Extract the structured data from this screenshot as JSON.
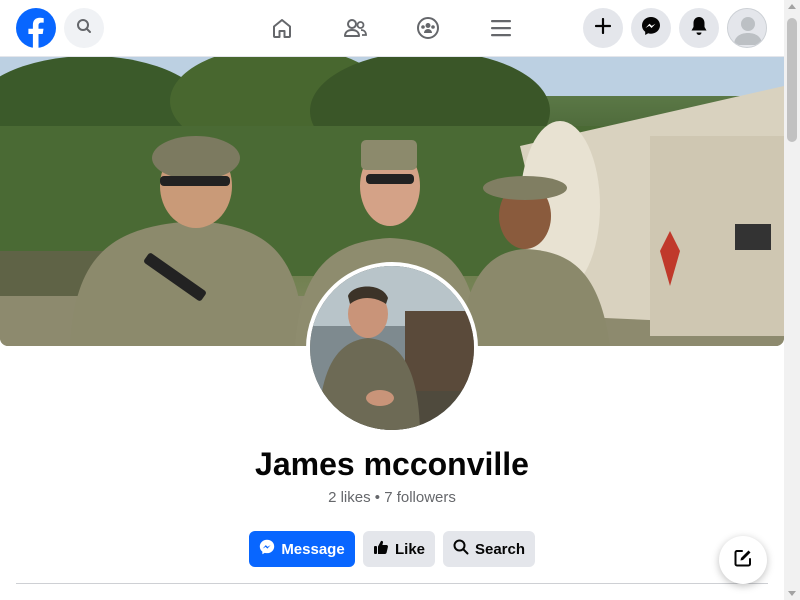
{
  "nav": {
    "logo_icon": "facebook-logo-icon",
    "search_icon": "search-icon",
    "center_icons": [
      "home-icon",
      "friends-icon",
      "groups-icon",
      "menu-icon"
    ],
    "right_icons": [
      "plus-icon",
      "messenger-icon",
      "bell-icon",
      "avatar"
    ]
  },
  "profile": {
    "name": "James mcconville",
    "stats": "2 likes • 7 followers"
  },
  "actions": {
    "message_label": "Message",
    "like_label": "Like",
    "search_label": "Search"
  },
  "colors": {
    "brand": "#0866ff",
    "secondary_button": "#e4e6eb",
    "text_primary": "#050505",
    "text_secondary": "#65676b"
  }
}
